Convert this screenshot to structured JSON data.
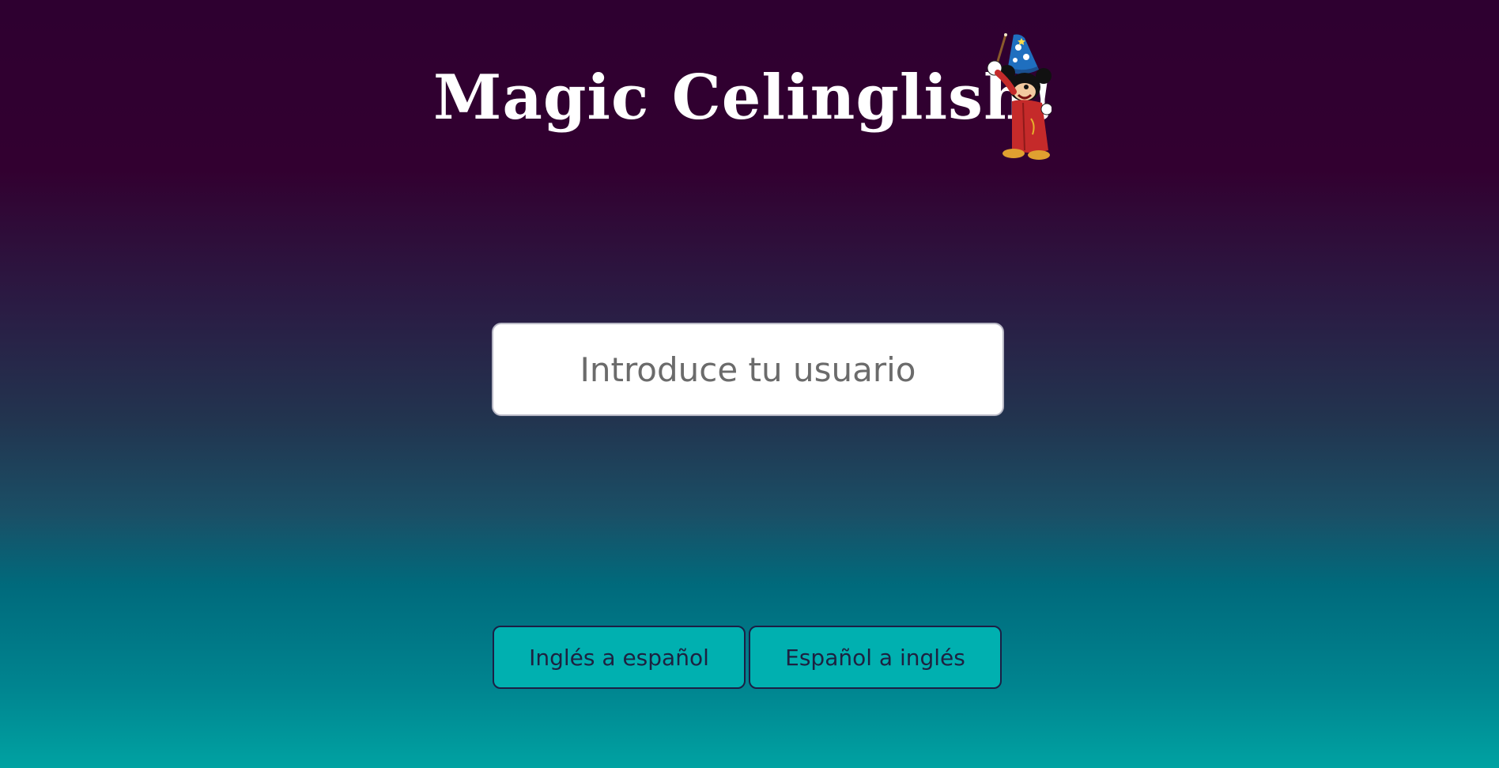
{
  "header": {
    "title": "Magic Celinglish!",
    "mascot_icon": "sorcerer-mickey-icon"
  },
  "login": {
    "username_placeholder": "Introduce tu usuario",
    "username_value": ""
  },
  "actions": {
    "english_to_spanish_label": "Inglés a español",
    "spanish_to_english_label": "Español a inglés"
  },
  "colors": {
    "background_top": "#320030",
    "background_bottom": "#00a2a2",
    "button_fill": "#00b0b0",
    "button_border": "#1b1f45",
    "title_text": "#ffffff"
  }
}
